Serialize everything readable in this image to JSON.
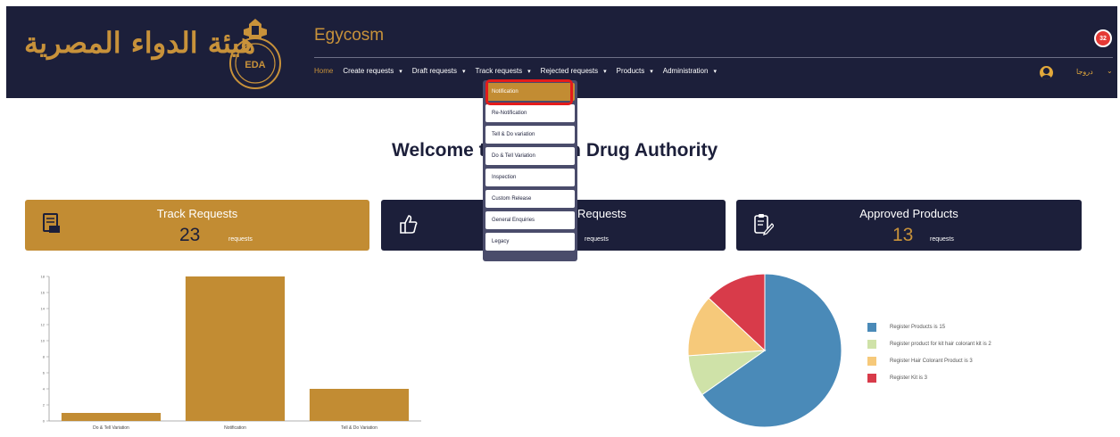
{
  "header": {
    "logo_arabic": "هيئة الدواء المصرية",
    "logo_emblem_text": "EDA",
    "app_title": "Egycosm",
    "nav": [
      {
        "label": "Home",
        "active": true,
        "has_menu": false
      },
      {
        "label": "Create requests",
        "active": false,
        "has_menu": true
      },
      {
        "label": "Draft requests",
        "active": false,
        "has_menu": true
      },
      {
        "label": "Track requests",
        "active": false,
        "has_menu": true
      },
      {
        "label": "Rejected requests",
        "active": false,
        "has_menu": true
      },
      {
        "label": "Products",
        "active": false,
        "has_menu": true
      },
      {
        "label": "Administration",
        "active": false,
        "has_menu": true
      }
    ],
    "notification_count": "32",
    "user_name": "دروجا"
  },
  "dropdown": {
    "items": [
      {
        "label": "Notification",
        "selected": true
      },
      {
        "label": "Re-Notification",
        "selected": false
      },
      {
        "label": "Tell & Do variation",
        "selected": false
      },
      {
        "label": "Do & Tell Variation",
        "selected": false
      },
      {
        "label": "Inspection",
        "selected": false
      },
      {
        "label": "Custom Release",
        "selected": false
      },
      {
        "label": "General Enquiries",
        "selected": false
      },
      {
        "label": "Legacy",
        "selected": false
      }
    ]
  },
  "welcome": {
    "text": "Welcome to Egyptian Drug Authority"
  },
  "cards": [
    {
      "title": "Track Requests",
      "count": "23",
      "unit": "requests",
      "icon": "document-stamp-icon"
    },
    {
      "title": "Requests",
      "count": "",
      "unit": "requests",
      "icon": "thumbs-up-icon"
    },
    {
      "title": "Approved Products",
      "count": "13",
      "unit": "requests",
      "icon": "clipboard-edit-icon"
    }
  ],
  "colors": {
    "navy": "#1c1f3a",
    "gold": "#c28c33",
    "highlight_red": "#e41b1b"
  },
  "chart_data": [
    {
      "type": "bar",
      "categories": [
        "Do & Tell Variation",
        "Notification",
        "Tell & Do Variation"
      ],
      "values": [
        1,
        18,
        4
      ],
      "ylim": [
        0,
        18
      ],
      "yticks": [
        0,
        2,
        4,
        6,
        8,
        10,
        12,
        14,
        16,
        18
      ],
      "color": "#c28c33",
      "grid": false
    },
    {
      "type": "pie",
      "labels": [
        "Register Products is 15",
        "Register product for kit hair colorant kit is 2",
        "Register Hair Colorant Product is 3",
        "Register Kit is 3"
      ],
      "values": [
        15,
        2,
        3,
        3
      ],
      "colors": [
        "#4a8ab8",
        "#cfe2a8",
        "#f6c97a",
        "#d83b4a"
      ],
      "legend": "right"
    }
  ]
}
